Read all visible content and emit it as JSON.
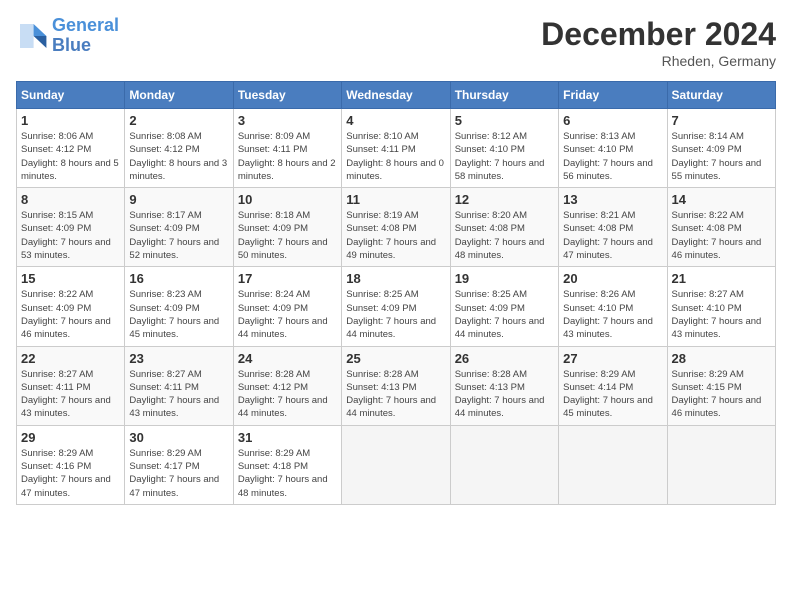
{
  "header": {
    "logo_line1": "General",
    "logo_line2": "Blue",
    "month": "December 2024",
    "location": "Rheden, Germany"
  },
  "weekdays": [
    "Sunday",
    "Monday",
    "Tuesday",
    "Wednesday",
    "Thursday",
    "Friday",
    "Saturday"
  ],
  "weeks": [
    [
      {
        "day": 1,
        "sunrise": "Sunrise: 8:06 AM",
        "sunset": "Sunset: 4:12 PM",
        "daylight": "Daylight: 8 hours and 5 minutes."
      },
      {
        "day": 2,
        "sunrise": "Sunrise: 8:08 AM",
        "sunset": "Sunset: 4:12 PM",
        "daylight": "Daylight: 8 hours and 3 minutes."
      },
      {
        "day": 3,
        "sunrise": "Sunrise: 8:09 AM",
        "sunset": "Sunset: 4:11 PM",
        "daylight": "Daylight: 8 hours and 2 minutes."
      },
      {
        "day": 4,
        "sunrise": "Sunrise: 8:10 AM",
        "sunset": "Sunset: 4:11 PM",
        "daylight": "Daylight: 8 hours and 0 minutes."
      },
      {
        "day": 5,
        "sunrise": "Sunrise: 8:12 AM",
        "sunset": "Sunset: 4:10 PM",
        "daylight": "Daylight: 7 hours and 58 minutes."
      },
      {
        "day": 6,
        "sunrise": "Sunrise: 8:13 AM",
        "sunset": "Sunset: 4:10 PM",
        "daylight": "Daylight: 7 hours and 56 minutes."
      },
      {
        "day": 7,
        "sunrise": "Sunrise: 8:14 AM",
        "sunset": "Sunset: 4:09 PM",
        "daylight": "Daylight: 7 hours and 55 minutes."
      }
    ],
    [
      {
        "day": 8,
        "sunrise": "Sunrise: 8:15 AM",
        "sunset": "Sunset: 4:09 PM",
        "daylight": "Daylight: 7 hours and 53 minutes."
      },
      {
        "day": 9,
        "sunrise": "Sunrise: 8:17 AM",
        "sunset": "Sunset: 4:09 PM",
        "daylight": "Daylight: 7 hours and 52 minutes."
      },
      {
        "day": 10,
        "sunrise": "Sunrise: 8:18 AM",
        "sunset": "Sunset: 4:09 PM",
        "daylight": "Daylight: 7 hours and 50 minutes."
      },
      {
        "day": 11,
        "sunrise": "Sunrise: 8:19 AM",
        "sunset": "Sunset: 4:08 PM",
        "daylight": "Daylight: 7 hours and 49 minutes."
      },
      {
        "day": 12,
        "sunrise": "Sunrise: 8:20 AM",
        "sunset": "Sunset: 4:08 PM",
        "daylight": "Daylight: 7 hours and 48 minutes."
      },
      {
        "day": 13,
        "sunrise": "Sunrise: 8:21 AM",
        "sunset": "Sunset: 4:08 PM",
        "daylight": "Daylight: 7 hours and 47 minutes."
      },
      {
        "day": 14,
        "sunrise": "Sunrise: 8:22 AM",
        "sunset": "Sunset: 4:08 PM",
        "daylight": "Daylight: 7 hours and 46 minutes."
      }
    ],
    [
      {
        "day": 15,
        "sunrise": "Sunrise: 8:22 AM",
        "sunset": "Sunset: 4:09 PM",
        "daylight": "Daylight: 7 hours and 46 minutes."
      },
      {
        "day": 16,
        "sunrise": "Sunrise: 8:23 AM",
        "sunset": "Sunset: 4:09 PM",
        "daylight": "Daylight: 7 hours and 45 minutes."
      },
      {
        "day": 17,
        "sunrise": "Sunrise: 8:24 AM",
        "sunset": "Sunset: 4:09 PM",
        "daylight": "Daylight: 7 hours and 44 minutes."
      },
      {
        "day": 18,
        "sunrise": "Sunrise: 8:25 AM",
        "sunset": "Sunset: 4:09 PM",
        "daylight": "Daylight: 7 hours and 44 minutes."
      },
      {
        "day": 19,
        "sunrise": "Sunrise: 8:25 AM",
        "sunset": "Sunset: 4:09 PM",
        "daylight": "Daylight: 7 hours and 44 minutes."
      },
      {
        "day": 20,
        "sunrise": "Sunrise: 8:26 AM",
        "sunset": "Sunset: 4:10 PM",
        "daylight": "Daylight: 7 hours and 43 minutes."
      },
      {
        "day": 21,
        "sunrise": "Sunrise: 8:27 AM",
        "sunset": "Sunset: 4:10 PM",
        "daylight": "Daylight: 7 hours and 43 minutes."
      }
    ],
    [
      {
        "day": 22,
        "sunrise": "Sunrise: 8:27 AM",
        "sunset": "Sunset: 4:11 PM",
        "daylight": "Daylight: 7 hours and 43 minutes."
      },
      {
        "day": 23,
        "sunrise": "Sunrise: 8:27 AM",
        "sunset": "Sunset: 4:11 PM",
        "daylight": "Daylight: 7 hours and 43 minutes."
      },
      {
        "day": 24,
        "sunrise": "Sunrise: 8:28 AM",
        "sunset": "Sunset: 4:12 PM",
        "daylight": "Daylight: 7 hours and 44 minutes."
      },
      {
        "day": 25,
        "sunrise": "Sunrise: 8:28 AM",
        "sunset": "Sunset: 4:13 PM",
        "daylight": "Daylight: 7 hours and 44 minutes."
      },
      {
        "day": 26,
        "sunrise": "Sunrise: 8:28 AM",
        "sunset": "Sunset: 4:13 PM",
        "daylight": "Daylight: 7 hours and 44 minutes."
      },
      {
        "day": 27,
        "sunrise": "Sunrise: 8:29 AM",
        "sunset": "Sunset: 4:14 PM",
        "daylight": "Daylight: 7 hours and 45 minutes."
      },
      {
        "day": 28,
        "sunrise": "Sunrise: 8:29 AM",
        "sunset": "Sunset: 4:15 PM",
        "daylight": "Daylight: 7 hours and 46 minutes."
      }
    ],
    [
      {
        "day": 29,
        "sunrise": "Sunrise: 8:29 AM",
        "sunset": "Sunset: 4:16 PM",
        "daylight": "Daylight: 7 hours and 47 minutes."
      },
      {
        "day": 30,
        "sunrise": "Sunrise: 8:29 AM",
        "sunset": "Sunset: 4:17 PM",
        "daylight": "Daylight: 7 hours and 47 minutes."
      },
      {
        "day": 31,
        "sunrise": "Sunrise: 8:29 AM",
        "sunset": "Sunset: 4:18 PM",
        "daylight": "Daylight: 7 hours and 48 minutes."
      },
      null,
      null,
      null,
      null
    ]
  ]
}
